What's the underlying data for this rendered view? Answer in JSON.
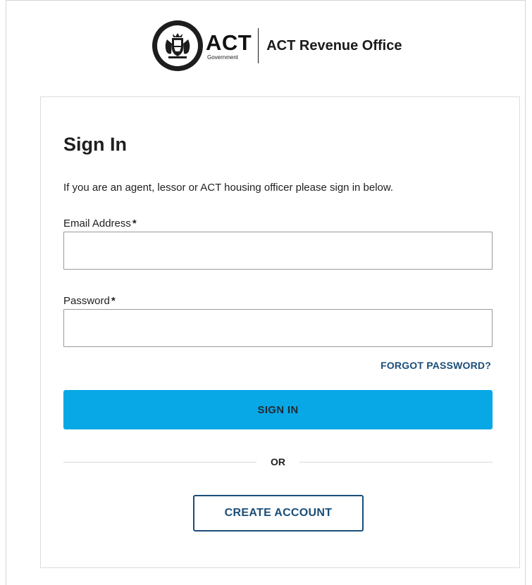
{
  "header": {
    "logo_text": "ACT",
    "logo_subtext": "Government",
    "office_name": "ACT Revenue Office"
  },
  "signin": {
    "title": "Sign In",
    "intro": "If you are an agent, lessor or ACT housing officer please sign in below.",
    "email_label": "Email Address",
    "email_value": "",
    "password_label": "Password",
    "password_value": "",
    "required_marker": "*",
    "forgot_password": "FORGOT PASSWORD?",
    "signin_button": "SIGN IN",
    "or_text": "OR",
    "create_account_button": "CREATE ACCOUNT"
  },
  "colors": {
    "primary_button": "#08a8e6",
    "link_navy": "#1a4d78",
    "border": "#9a9a9a"
  },
  "icons": {
    "logo": "act-government-crest-icon"
  }
}
